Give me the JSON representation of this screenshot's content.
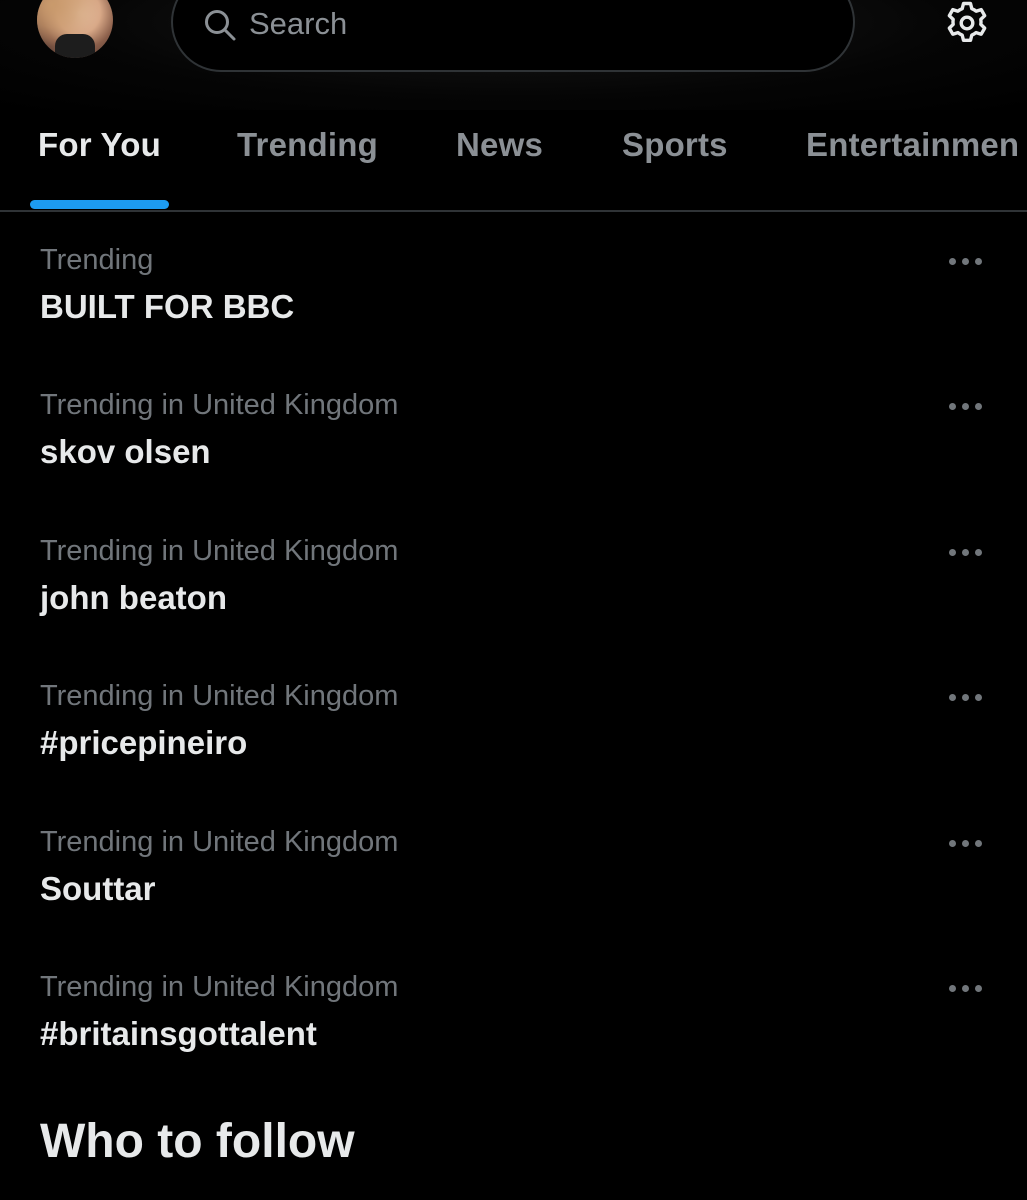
{
  "header": {
    "search_placeholder": "Search",
    "avatar_icon": "user-avatar",
    "search_icon": "search-icon",
    "settings_icon": "gear-icon"
  },
  "tabs": [
    {
      "label": "For You",
      "active": true
    },
    {
      "label": "Trending",
      "active": false
    },
    {
      "label": "News",
      "active": false
    },
    {
      "label": "Sports",
      "active": false
    },
    {
      "label": "Entertainmen",
      "active": false
    }
  ],
  "trends": [
    {
      "context": "Trending",
      "title": "BUILT FOR BBC"
    },
    {
      "context": "Trending in United Kingdom",
      "title": "skov olsen"
    },
    {
      "context": "Trending in United Kingdom",
      "title": "john beaton"
    },
    {
      "context": "Trending in United Kingdom",
      "title": "#pricepineiro"
    },
    {
      "context": "Trending in United Kingdom",
      "title": "Souttar"
    },
    {
      "context": "Trending in United Kingdom",
      "title": "#britainsgottalent"
    }
  ],
  "who_to_follow": {
    "title": "Who to follow"
  },
  "colors": {
    "background": "#000000",
    "accent": "#1d9bf0",
    "primary_text": "#e7e9ea",
    "secondary_text": "#71767b"
  }
}
